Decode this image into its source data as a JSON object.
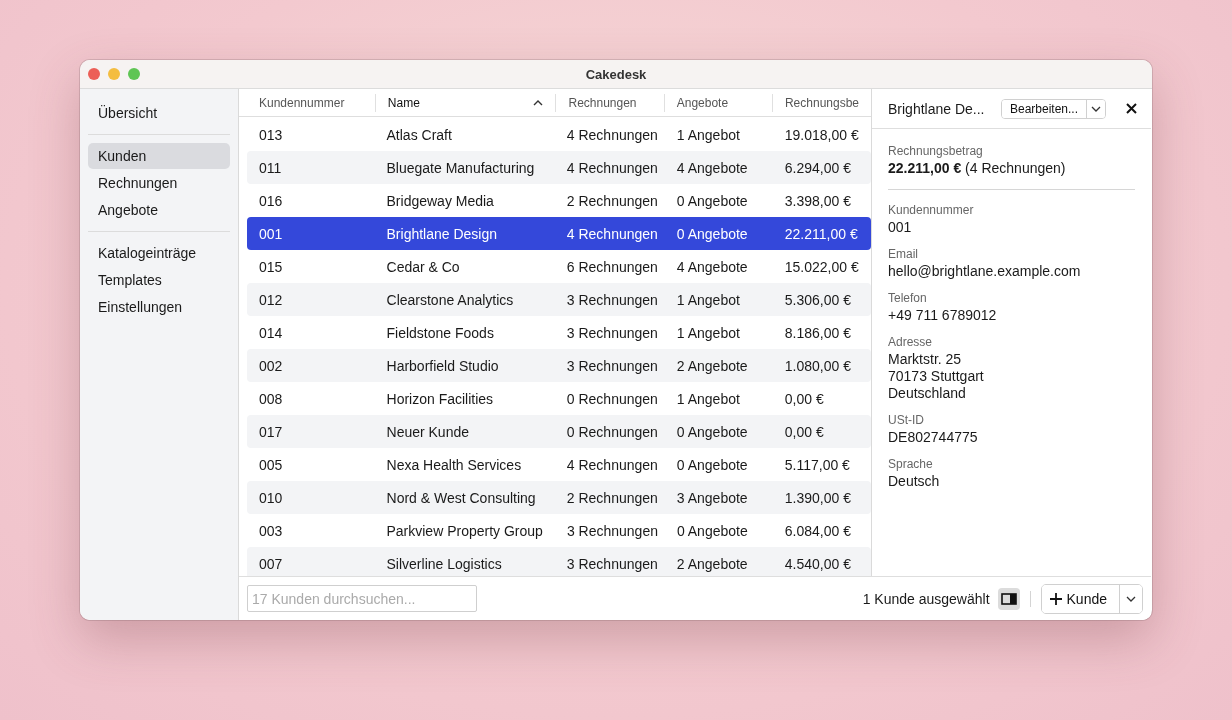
{
  "window": {
    "title": "Cakedesk"
  },
  "sidebar": {
    "groups": [
      {
        "items": [
          {
            "label": "Übersicht",
            "selected": false
          }
        ]
      },
      {
        "items": [
          {
            "label": "Kunden",
            "selected": true
          },
          {
            "label": "Rechnungen",
            "selected": false
          },
          {
            "label": "Angebote",
            "selected": false
          }
        ]
      },
      {
        "items": [
          {
            "label": "Katalogeinträge",
            "selected": false
          },
          {
            "label": "Templates",
            "selected": false
          },
          {
            "label": "Einstellungen",
            "selected": false
          }
        ]
      }
    ]
  },
  "table": {
    "columns": [
      {
        "label": "Kundennummer",
        "sorted": false
      },
      {
        "label": "Name",
        "sorted": true
      },
      {
        "label": "Rechnungen",
        "sorted": false
      },
      {
        "label": "Angebote",
        "sorted": false
      },
      {
        "label": "Rechnungsbe",
        "sorted": false
      }
    ],
    "rows": [
      {
        "cells": [
          "013",
          "Atlas Craft",
          "4 Rechnungen",
          "1 Angebot",
          "19.018,00 €"
        ],
        "selected": false
      },
      {
        "cells": [
          "011",
          "Bluegate Manufacturing",
          "4 Rechnungen",
          "4 Angebote",
          "6.294,00 €"
        ],
        "selected": false
      },
      {
        "cells": [
          "016",
          "Bridgeway Media",
          "2 Rechnungen",
          "0 Angebote",
          "3.398,00 €"
        ],
        "selected": false
      },
      {
        "cells": [
          "001",
          "Brightlane Design",
          "4 Rechnungen",
          "0 Angebote",
          "22.211,00 €"
        ],
        "selected": true
      },
      {
        "cells": [
          "015",
          "Cedar & Co",
          "6 Rechnungen",
          "4 Angebote",
          "15.022,00 €"
        ],
        "selected": false
      },
      {
        "cells": [
          "012",
          "Clearstone Analytics",
          "3 Rechnungen",
          "1 Angebot",
          "5.306,00 €"
        ],
        "selected": false
      },
      {
        "cells": [
          "014",
          "Fieldstone Foods",
          "3 Rechnungen",
          "1 Angebot",
          "8.186,00 €"
        ],
        "selected": false
      },
      {
        "cells": [
          "002",
          "Harborfield Studio",
          "3 Rechnungen",
          "2 Angebote",
          "1.080,00 €"
        ],
        "selected": false
      },
      {
        "cells": [
          "008",
          "Horizon Facilities",
          "0 Rechnungen",
          "1 Angebot",
          "0,00 €"
        ],
        "selected": false
      },
      {
        "cells": [
          "017",
          "Neuer Kunde",
          "0 Rechnungen",
          "0 Angebote",
          "0,00 €"
        ],
        "selected": false
      },
      {
        "cells": [
          "005",
          "Nexa Health Services",
          "4 Rechnungen",
          "0 Angebote",
          "5.117,00 €"
        ],
        "selected": false
      },
      {
        "cells": [
          "010",
          "Nord & West Consulting",
          "2 Rechnungen",
          "3 Angebote",
          "1.390,00 €"
        ],
        "selected": false
      },
      {
        "cells": [
          "003",
          "Parkview Property Group",
          "3 Rechnungen",
          "0 Angebote",
          "6.084,00 €"
        ],
        "selected": false
      },
      {
        "cells": [
          "007",
          "Silverline Logistics",
          "3 Rechnungen",
          "2 Angebote",
          "4.540,00 €"
        ],
        "selected": false
      }
    ]
  },
  "search": {
    "placeholder": "17 Kunden durchsuchen..."
  },
  "selection_status": "1 Kunde ausgewählt",
  "add_button": {
    "label": "Kunde"
  },
  "detail": {
    "title": "Brightlane De...",
    "edit_button": "Bearbeiten...",
    "summary": {
      "label": "Rechnungsbetrag",
      "value": "**22.211,00 €** (4 Rechnungen)"
    },
    "fields": [
      {
        "label": "Kundennummer",
        "lines": [
          "001"
        ]
      },
      {
        "label": "Email",
        "lines": [
          "hello@brightlane.example.com"
        ]
      },
      {
        "label": "Telefon",
        "lines": [
          "+49 711 6789012"
        ]
      },
      {
        "label": "Adresse",
        "lines": [
          "Marktstr. 25",
          "70173 Stuttgart",
          "Deutschland"
        ]
      },
      {
        "label": "USt-ID",
        "lines": [
          "DE802744775"
        ]
      },
      {
        "label": "Sprache",
        "lines": [
          "Deutsch"
        ]
      }
    ]
  }
}
